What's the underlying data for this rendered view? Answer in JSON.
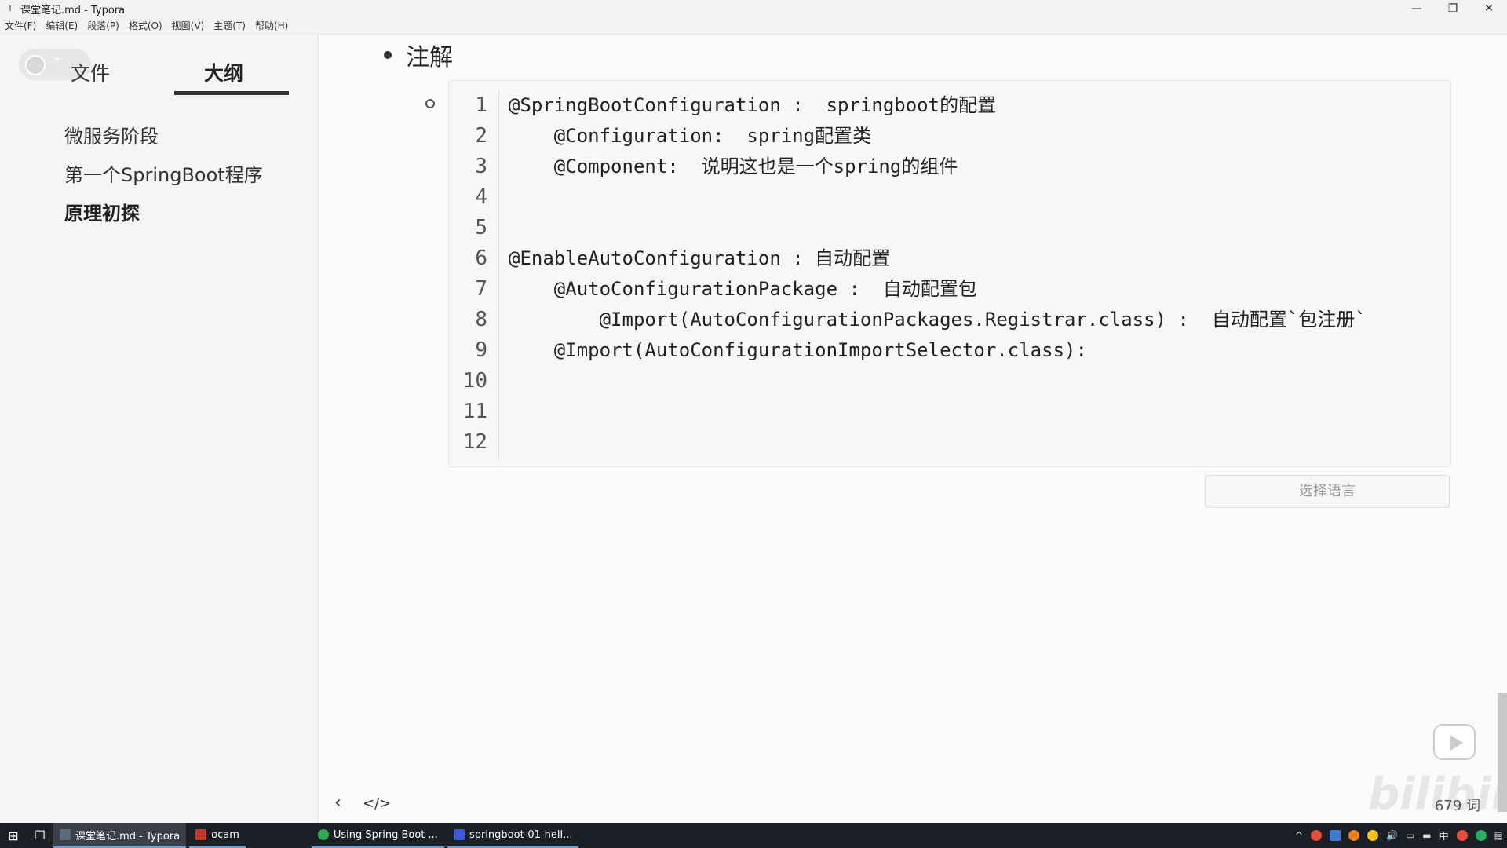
{
  "window": {
    "title": "课堂笔记.md - Typora",
    "controls": [
      "—",
      "❐",
      "✕"
    ]
  },
  "menu": [
    "文件(F)",
    "编辑(E)",
    "段落(P)",
    "格式(O)",
    "视图(V)",
    "主题(T)",
    "帮助(H)"
  ],
  "sidebar": {
    "tabs": [
      {
        "label": "文件"
      },
      {
        "label": "大纲"
      }
    ],
    "outline": [
      {
        "label": "微服务阶段"
      },
      {
        "label": "第一个SpringBoot程序"
      },
      {
        "label": "原理初探"
      }
    ],
    "footer_back": "‹",
    "footer_source": "</>"
  },
  "main": {
    "heading": "注解",
    "code_lines": [
      "@SpringBootConfiguration :  springboot的配置",
      "    @Configuration:  spring配置类",
      "    @Component:  说明这也是一个spring的组件",
      "",
      "",
      "@EnableAutoConfiguration : 自动配置",
      "    @AutoConfigurationPackage :  自动配置包",
      "        @Import(AutoConfigurationPackages.Registrar.class) :  自动配置`包注册`",
      "    @Import(AutoConfigurationImportSelector.class):",
      "",
      "",
      ""
    ],
    "line_numbers": [
      "1",
      "2",
      "3",
      "4",
      "5",
      "6",
      "7",
      "8",
      "9",
      "10",
      "11",
      "12"
    ],
    "language_select": "选择语言",
    "word_count": "679 词",
    "watermark": "bilibili"
  },
  "taskbar": {
    "tasks": [
      {
        "label": "课堂笔记.md - Typora",
        "color": "#5a6b7c"
      },
      {
        "label": "ocam",
        "color": "#c0392b"
      },
      {
        "label": "Using Spring Boot ...",
        "color": "#34a853"
      },
      {
        "label": "springboot-01-hell...",
        "color": "#3b5bdb"
      }
    ],
    "tray": [
      "^",
      "中"
    ]
  }
}
